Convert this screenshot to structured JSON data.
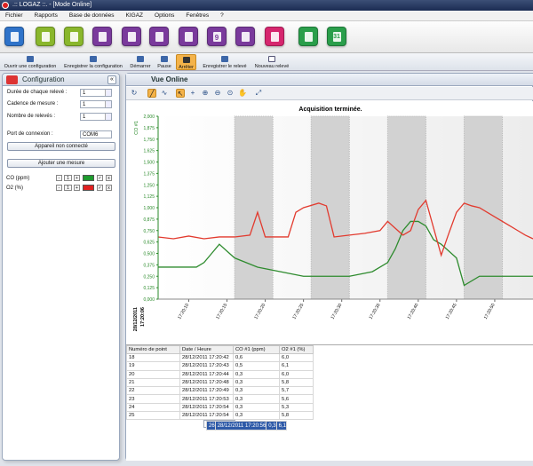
{
  "window": {
    "title": ".:: LOGAZ ::. - [Mode Online]"
  },
  "menu": [
    "Fichier",
    "Rapports",
    "Base de données",
    "KIGAZ",
    "Options",
    "Fenêtres",
    "?"
  ],
  "iconbar": {
    "colors": [
      "#2f73c9",
      "#8ab72c",
      "#8ab72c",
      "#7a3a9c",
      "#7a3a9c",
      "#7a3a9c",
      "#7a3a9c",
      "#7a3a9c",
      "#7a3a9c",
      "#7a3a9c",
      "#d6266e",
      "#2a9e4b",
      "#2a9e4b"
    ],
    "day_badge_1": "9",
    "day_badge_2": "31"
  },
  "toolbar": {
    "open_config": "Ouvrir une configuration",
    "save_config": "Enregistrer la configuration",
    "start": "Démarrer",
    "pause": "Pause",
    "stop": "Arrêter",
    "save_reading": "Enregistrer le relevé",
    "new_reading": "Nouveau relevé"
  },
  "config": {
    "title": "Configuration",
    "duration_label": "Durée de chaque relevé :",
    "duration_value": "1",
    "rate_label": "Cadence de mesure :",
    "rate_value": "1",
    "count_label": "Nombre de relevés :",
    "count_value": "1",
    "port_label": "Port de connexion :",
    "port_value": "COM6",
    "status_button": "Appareil non connecté",
    "add_measure_button": "Ajouter une mesure",
    "measures": [
      {
        "name": "CO (ppm)",
        "value": "1",
        "color": "#1e9a2e"
      },
      {
        "name": "O2 (%)",
        "value": "1",
        "color": "#e02020"
      }
    ]
  },
  "online": {
    "title": "Vue Online",
    "chart_title": "Acquisition terminée.",
    "y_axis_label": "CO #1",
    "start_date": "28/12/2011",
    "start_time": "17:20:06"
  },
  "chart_data": {
    "type": "line",
    "title": "Acquisition terminée.",
    "ylabel": "CO #1",
    "ylim": [
      0,
      2
    ],
    "y_ticks": [
      "0,000",
      "0,125",
      "0,250",
      "0,375",
      "0,500",
      "0,625",
      "0,750",
      "0,875",
      "1,000",
      "1,125",
      "1,250",
      "1,375",
      "1,500",
      "1,625",
      "1,750",
      "1,875",
      "2,000"
    ],
    "x_ticks": [
      "17:20:10",
      "17:20:15",
      "17:20:20",
      "17:20:25",
      "17:20:30",
      "17:20:35",
      "17:20:40",
      "17:20:45",
      "17:20:50"
    ],
    "xlim": [
      0,
      49
    ],
    "shaded_bands": [
      [
        10,
        15
      ],
      [
        20,
        25
      ],
      [
        30,
        35
      ],
      [
        40,
        45
      ]
    ],
    "grid": "none",
    "series": [
      {
        "name": "CO #1",
        "color": "#2e8b2e",
        "x": [
          0,
          5,
          6,
          7,
          8,
          10,
          13,
          16,
          19,
          22,
          25,
          28,
          30,
          31,
          32,
          33,
          34,
          35,
          36,
          37,
          39,
          40,
          42,
          46,
          49
        ],
        "y": [
          0.35,
          0.35,
          0.4,
          0.5,
          0.6,
          0.45,
          0.35,
          0.3,
          0.25,
          0.25,
          0.25,
          0.3,
          0.4,
          0.55,
          0.75,
          0.85,
          0.85,
          0.8,
          0.65,
          0.6,
          0.45,
          0.15,
          0.25,
          0.25,
          0.25
        ]
      },
      {
        "name": "O2 #1",
        "color": "#e23a2e",
        "x": [
          0,
          2,
          4,
          6,
          8,
          10,
          12,
          13,
          14,
          16,
          17,
          18,
          19,
          21,
          22,
          23,
          25,
          27,
          29,
          30,
          32,
          33,
          34,
          35,
          37,
          38,
          39,
          40,
          41,
          42,
          44,
          45,
          46,
          47,
          48,
          49
        ],
        "y": [
          0.68,
          0.66,
          0.69,
          0.66,
          0.68,
          0.68,
          0.7,
          0.95,
          0.68,
          0.68,
          0.68,
          0.95,
          1.0,
          1.05,
          1.02,
          0.68,
          0.7,
          0.72,
          0.75,
          0.85,
          0.7,
          0.75,
          0.98,
          1.08,
          0.48,
          0.72,
          0.95,
          1.05,
          1.02,
          1.0,
          0.9,
          0.85,
          0.8,
          0.75,
          0.7,
          0.66
        ]
      }
    ]
  },
  "table": {
    "headers": [
      "Numéro de point",
      "Date / Heure",
      "CO #1 (ppm)",
      "O2 #1 (%)"
    ],
    "rows": [
      [
        "18",
        "28/12/2011 17:20:42",
        "0,6",
        "6,0"
      ],
      [
        "19",
        "28/12/2011 17:20:43",
        "0,5",
        "6,1"
      ],
      [
        "20",
        "28/12/2011 17:20:44",
        "0,3",
        "6,0"
      ],
      [
        "21",
        "28/12/2011 17:20:48",
        "0,3",
        "5,8"
      ],
      [
        "22",
        "28/12/2011 17:20:49",
        "0,3",
        "5,7"
      ],
      [
        "23",
        "28/12/2011 17:20:53",
        "0,3",
        "5,6"
      ],
      [
        "24",
        "28/12/2011 17:20:54",
        "0,3",
        "5,3"
      ],
      [
        "25",
        "28/12/2011 17:20:54",
        "0,3",
        "5,8"
      ],
      [
        "26",
        "28/12/2011 17:20:56",
        "0,3",
        "6,1"
      ]
    ],
    "selected_row": "26"
  }
}
